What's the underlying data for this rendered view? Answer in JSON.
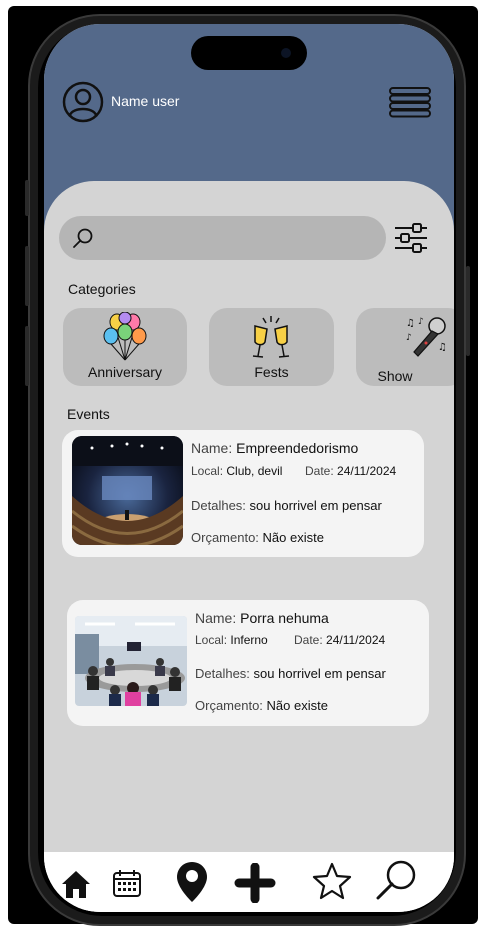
{
  "header": {
    "user_name": "Name user"
  },
  "search": {
    "placeholder": ""
  },
  "categories": {
    "title": "Categories",
    "items": [
      {
        "label": "Anniversary",
        "icon": "balloons-icon"
      },
      {
        "label": "Fests",
        "icon": "champagne-toast-icon"
      },
      {
        "label": "Show",
        "icon": "microphone-icon"
      }
    ]
  },
  "events": {
    "title": "Events",
    "labels": {
      "name": "Name:",
      "local": "Local:",
      "date": "Date:",
      "details": "Detalhes:",
      "budget": "Orçamento:"
    },
    "items": [
      {
        "name": "Empreendedorismo",
        "local": "Club, devil",
        "date": "24/11/2024",
        "details": "sou horrivel em pensar",
        "budget": "Não existe",
        "photo": "conference-auditorium-photo"
      },
      {
        "name": "Porra nehuma",
        "local": "Inferno",
        "date": "24/11/2024",
        "details": "sou horrivel em pensar",
        "budget": "Não existe",
        "photo": "meeting-room-photo"
      }
    ]
  },
  "bottom_nav": {
    "items": [
      "home-icon",
      "calendar-icon",
      "location-pin-icon",
      "plus-icon",
      "star-icon",
      "search-icon"
    ]
  },
  "colors": {
    "header": "#54698a",
    "panel": "#d4d4d4",
    "search_bar": "#b5b5b5",
    "category_tile": "#bcbcbc",
    "card": "#f4f4f4"
  }
}
